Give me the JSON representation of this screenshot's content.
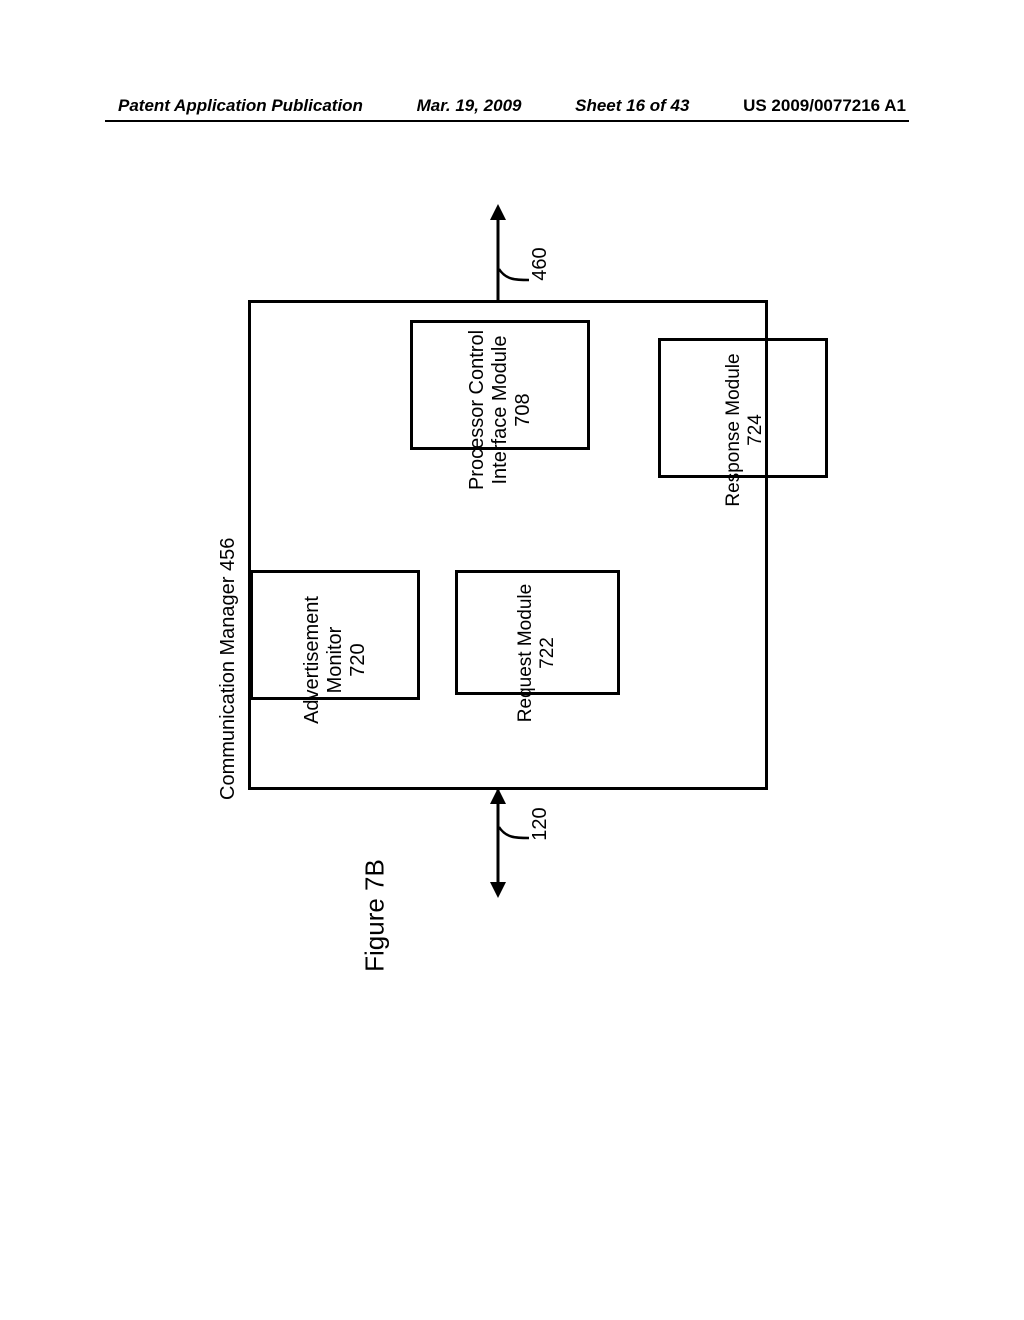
{
  "header": {
    "left": "Patent Application Publication",
    "date": "Mar. 19, 2009",
    "sheet": "Sheet 16 of 43",
    "pub_id": "US 2009/0077216 A1"
  },
  "diagram": {
    "container_label": "Communication Manager 456",
    "arrow_top_ref": "460",
    "arrow_bottom_ref": "120",
    "boxes": {
      "pci": {
        "l1": "Processor Control",
        "l2": "Interface Module",
        "num": "708"
      },
      "adv": {
        "l1": "Advertisement",
        "l2": "Monitor",
        "num": "720"
      },
      "req": {
        "l1": "Request Module",
        "num": "722"
      },
      "resp": {
        "l1": "Response Module",
        "num": "724"
      }
    },
    "figure_label": "Figure 7B"
  }
}
